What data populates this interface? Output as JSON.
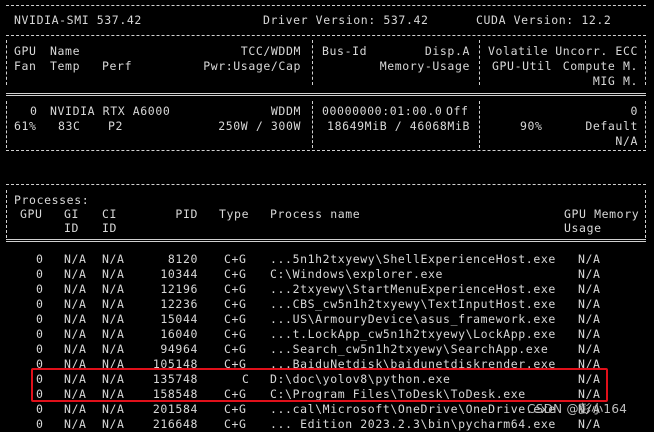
{
  "header": {
    "smi": "NVIDIA-SMI 537.42",
    "driver": "Driver Version: 537.42",
    "cuda": "CUDA Version: 12.2"
  },
  "columns": {
    "gpu": "GPU",
    "name": "Name",
    "tcc": "TCC/WDDM",
    "busid": "Bus-Id",
    "dispa": "Disp.A",
    "volatile": "Volatile",
    "uncorr": "Uncorr. ECC",
    "fan": "Fan",
    "temp": "Temp",
    "perf": "Perf",
    "pwr": "Pwr:Usage/Cap",
    "memusage": "Memory-Usage",
    "gpuutil": "GPU-Util",
    "compute": "Compute M.",
    "mig": "MIG M."
  },
  "gpu": {
    "index": "0",
    "name": "NVIDIA RTX A6000",
    "mode": "WDDM",
    "busid": "00000000:01:00.0",
    "disp": "Off",
    "ecc": "0",
    "fan": "61%",
    "temp": "83C",
    "perf": "P2",
    "power": "250W / 300W",
    "memory": "18649MiB / 46068MiB",
    "util": "90%",
    "compute": "Default",
    "mig": "N/A"
  },
  "processes": {
    "title": "Processes:",
    "headers": {
      "gpu": "GPU",
      "gi": "GI",
      "ci": "CI",
      "pid": "PID",
      "type": "Type",
      "name": "Process name",
      "mem": "GPU Memory",
      "id_gi": "ID",
      "id_ci": "ID",
      "usage": "Usage"
    },
    "rows": [
      {
        "gpu": "0",
        "gi": "N/A",
        "ci": "N/A",
        "pid": "8120",
        "type": "C+G",
        "name": "...5n1h2txyewy\\ShellExperienceHost.exe",
        "mem": "N/A"
      },
      {
        "gpu": "0",
        "gi": "N/A",
        "ci": "N/A",
        "pid": "10344",
        "type": "C+G",
        "name": "C:\\Windows\\explorer.exe",
        "mem": "N/A"
      },
      {
        "gpu": "0",
        "gi": "N/A",
        "ci": "N/A",
        "pid": "12196",
        "type": "C+G",
        "name": "...2txyewy\\StartMenuExperienceHost.exe",
        "mem": "N/A"
      },
      {
        "gpu": "0",
        "gi": "N/A",
        "ci": "N/A",
        "pid": "12236",
        "type": "C+G",
        "name": "...CBS_cw5n1h2txyewy\\TextInputHost.exe",
        "mem": "N/A"
      },
      {
        "gpu": "0",
        "gi": "N/A",
        "ci": "N/A",
        "pid": "15044",
        "type": "C+G",
        "name": "...US\\ArmouryDevice\\asus_framework.exe",
        "mem": "N/A"
      },
      {
        "gpu": "0",
        "gi": "N/A",
        "ci": "N/A",
        "pid": "16040",
        "type": "C+G",
        "name": "...t.LockApp_cw5n1h2txyewy\\LockApp.exe",
        "mem": "N/A"
      },
      {
        "gpu": "0",
        "gi": "N/A",
        "ci": "N/A",
        "pid": "94964",
        "type": "C+G",
        "name": "...Search_cw5n1h2txyewy\\SearchApp.exe",
        "mem": "N/A"
      },
      {
        "gpu": "0",
        "gi": "N/A",
        "ci": "N/A",
        "pid": "105148",
        "type": "C+G",
        "name": "...BaiduNetdisk\\baidunetdiskrender.exe",
        "mem": "N/A"
      },
      {
        "gpu": "0",
        "gi": "N/A",
        "ci": "N/A",
        "pid": "135748",
        "type": "C",
        "name": "D:\\doc\\yolov8\\python.exe",
        "mem": "N/A"
      },
      {
        "gpu": "0",
        "gi": "N/A",
        "ci": "N/A",
        "pid": "158548",
        "type": "C+G",
        "name": "C:\\Program Files\\ToDesk\\ToDesk.exe",
        "mem": "N/A"
      },
      {
        "gpu": "0",
        "gi": "N/A",
        "ci": "N/A",
        "pid": "201584",
        "type": "C+G",
        "name": "...cal\\Microsoft\\OneDrive\\OneDrive.exe",
        "mem": "N/A"
      },
      {
        "gpu": "0",
        "gi": "N/A",
        "ci": "N/A",
        "pid": "216648",
        "type": "C+G",
        "name": "... Edition 2023.2.3\\bin\\pycharm64.exe",
        "mem": "N/A"
      }
    ]
  },
  "watermark": "CSDN @彭小164",
  "colors": {
    "background": "#000000",
    "text": "#d8d8d8",
    "highlight": "#e0101a"
  }
}
